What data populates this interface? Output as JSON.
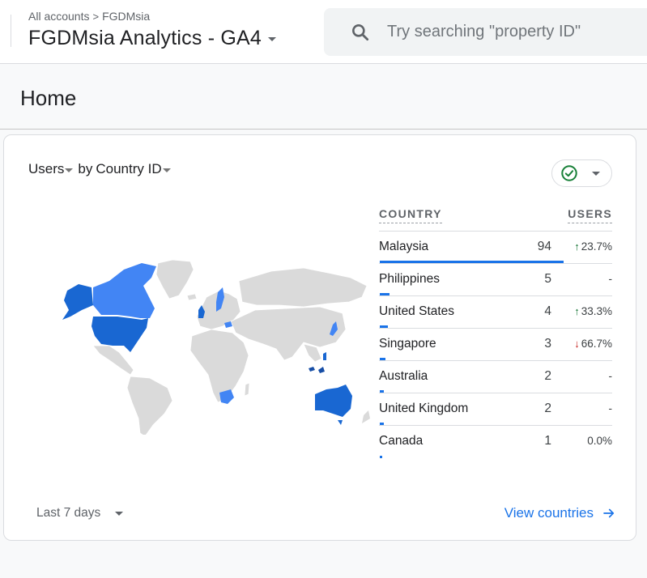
{
  "header": {
    "breadcrumb": {
      "root": "All accounts",
      "separator": ">",
      "account": "FGDMsia"
    },
    "property_name": "FGDMsia Analytics - GA4",
    "search": {
      "placeholder": "Try searching \"property ID\"",
      "value": ""
    }
  },
  "page": {
    "title": "Home"
  },
  "card": {
    "metric_label": "Users",
    "by_label": "by",
    "dimension_label": "Country ID",
    "status_icon": "check-circle-icon",
    "status_color": "#188038",
    "accent_color": "#1a73e8",
    "table": {
      "col_country": "COUNTRY",
      "col_users": "USERS",
      "rows": [
        {
          "country": "Malaysia",
          "users": "94",
          "change": "23.7%",
          "direction": "up",
          "share": 0.81
        },
        {
          "country": "Philippines",
          "users": "5",
          "change": "-",
          "direction": "none",
          "share": 0.043
        },
        {
          "country": "United States",
          "users": "4",
          "change": "33.3%",
          "direction": "up",
          "share": 0.034
        },
        {
          "country": "Singapore",
          "users": "3",
          "change": "66.7%",
          "direction": "down",
          "share": 0.026
        },
        {
          "country": "Australia",
          "users": "2",
          "change": "-",
          "direction": "none",
          "share": 0.017
        },
        {
          "country": "United Kingdom",
          "users": "2",
          "change": "-",
          "direction": "none",
          "share": 0.017
        },
        {
          "country": "Canada",
          "users": "1",
          "change": "0.0%",
          "direction": "none",
          "share": 0.009
        }
      ]
    },
    "map": {
      "highlighted": [
        {
          "region": "United States",
          "shade": "#1967d2"
        },
        {
          "region": "Alaska",
          "shade": "#1967d2"
        },
        {
          "region": "Canada",
          "shade": "#4285f4"
        },
        {
          "region": "Australia",
          "shade": "#1967d2"
        },
        {
          "region": "United Kingdom",
          "shade": "#1967d2"
        },
        {
          "region": "Sweden",
          "shade": "#4285f4"
        },
        {
          "region": "South Africa",
          "shade": "#4285f4"
        },
        {
          "region": "Japan",
          "shade": "#4285f4"
        }
      ]
    },
    "date_range": "Last 7 days",
    "view_link": "View countries"
  }
}
